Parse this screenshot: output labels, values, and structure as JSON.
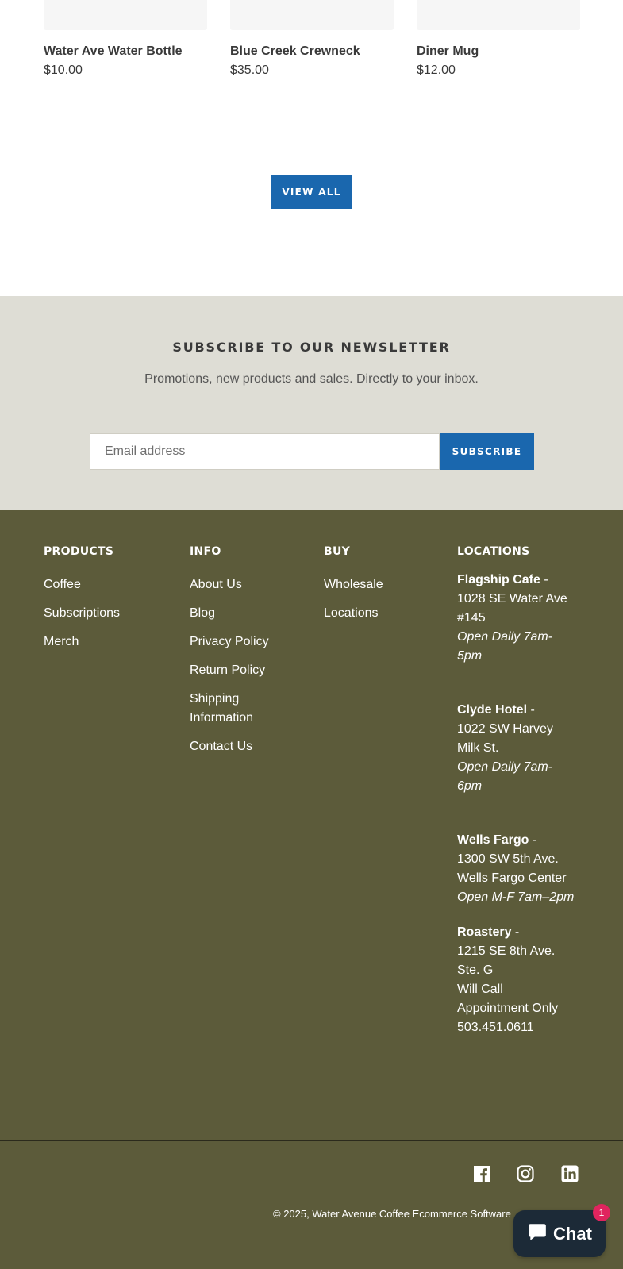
{
  "products": [
    {
      "name": "Water Ave Water Bottle",
      "price": "$10.00"
    },
    {
      "name": "Blue Creek Crewneck",
      "price": "$35.00"
    },
    {
      "name": "Diner Mug",
      "price": "$12.00"
    }
  ],
  "view_all_label": "VIEW ALL",
  "newsletter": {
    "title": "SUBSCRIBE TO OUR NEWSLETTER",
    "subtitle": "Promotions, new products and sales. Directly to your inbox.",
    "email_placeholder": "Email address",
    "subscribe_label": "SUBSCRIBE"
  },
  "footer": {
    "products": {
      "title": "PRODUCTS",
      "links": [
        "Coffee",
        "Subscriptions",
        "Merch"
      ]
    },
    "info": {
      "title": "INFO",
      "links": [
        "About Us",
        "Blog",
        "Privacy Policy",
        "Return Policy",
        "Shipping Information",
        "Contact Us"
      ]
    },
    "buy": {
      "title": "BUY",
      "links": [
        "Wholesale",
        "Locations"
      ]
    },
    "locations": {
      "title": "LOCATIONS",
      "items": [
        {
          "name": "Flagship Cafe",
          "sep": " -",
          "address": "1028 SE Water Ave #145",
          "hours": "Open Daily 7am-5pm"
        },
        {
          "name": "Clyde Hotel",
          "sep": " -",
          "address": "1022 SW Harvey Milk St.",
          "hours": "Open Daily 7am-6pm"
        },
        {
          "name": "Wells Fargo",
          "sep": " -",
          "address": "1300 SW 5th Ave. Wells Fargo Center",
          "hours": "Open M-F 7am–2pm"
        },
        {
          "name": "Roastery",
          "sep": " -",
          "address": "1215 SE 8th Ave. Ste. G",
          "note": "Will Call Appointment Only",
          "phone": "503.451.0611"
        }
      ]
    },
    "social": [
      "facebook-icon",
      "instagram-icon",
      "linkedin-icon"
    ],
    "copyright_prefix": "© 2025,",
    "copyright_link": "Water Avenue Coffee Ecommerce Software"
  },
  "chat": {
    "label": "Chat",
    "badge": "1"
  },
  "colors": {
    "accent": "#1a67ae",
    "footer_bg": "#5c5b3a",
    "newsletter_bg": "#deddd5",
    "chat_bg": "#1c2a37",
    "badge": "#e0245e"
  }
}
